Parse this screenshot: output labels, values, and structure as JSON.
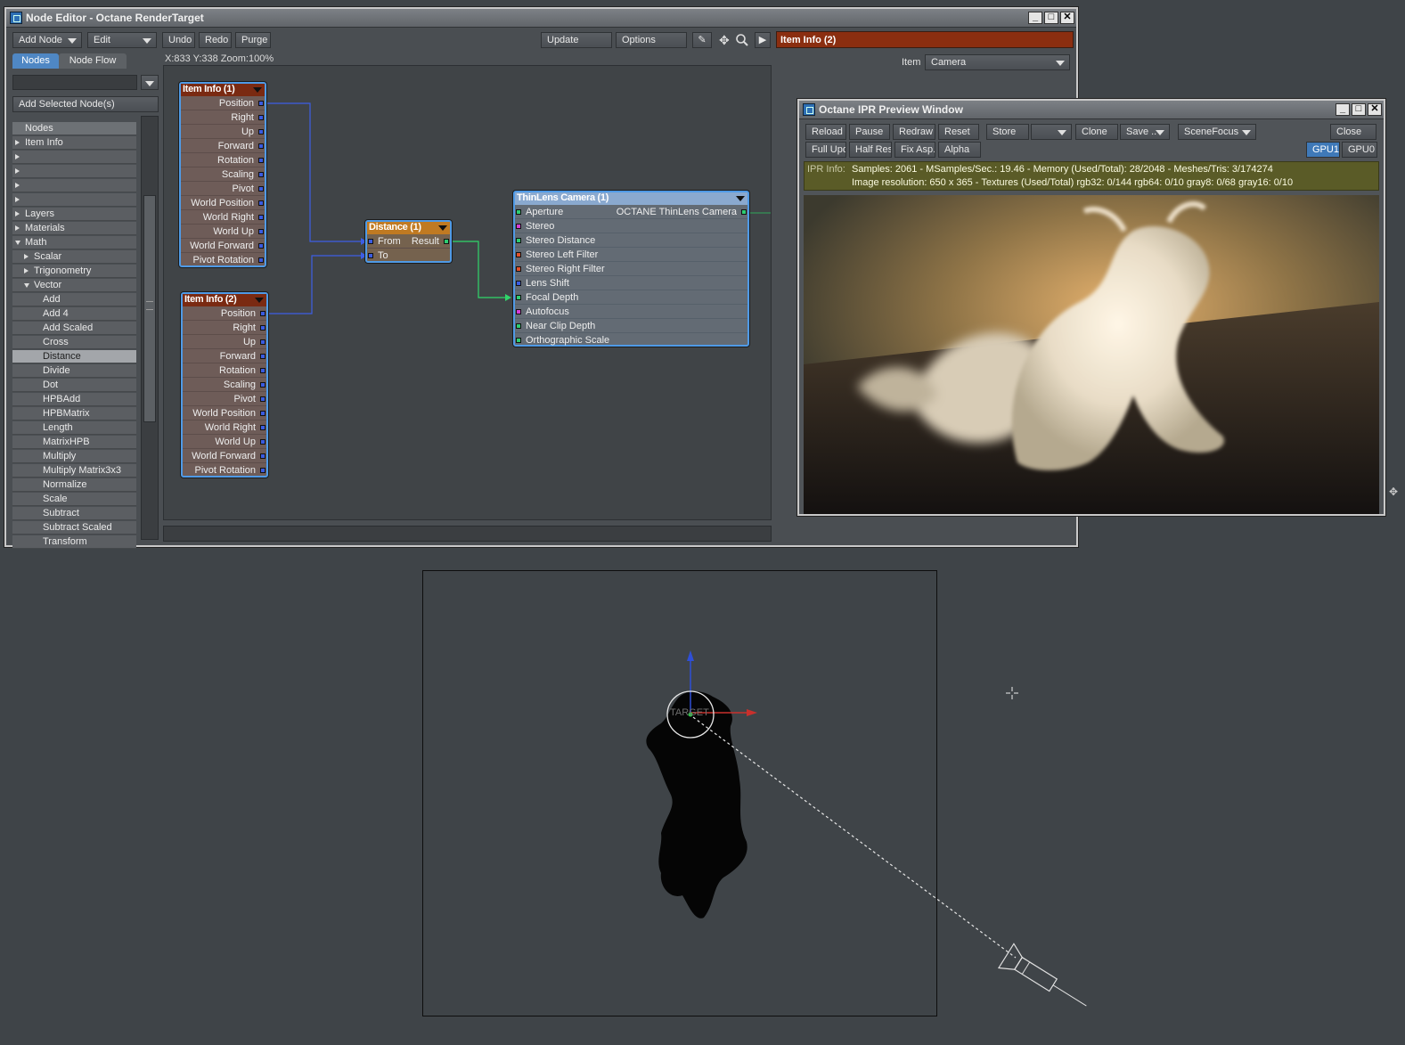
{
  "node_editor": {
    "title": "Node Editor - Octane RenderTarget",
    "toolbar": {
      "add_node": "Add Node",
      "edit": "Edit",
      "undo": "Undo",
      "redo": "Redo",
      "purge": "Purge",
      "update": "Update",
      "options": "Options"
    },
    "tabs": [
      "Nodes",
      "Node Flow"
    ],
    "add_selected": "Add Selected Node(s)",
    "coords": "X:833 Y:338 Zoom:100%",
    "selected_node": "Item Info (2)",
    "item_label": "Item",
    "item_value": "Camera",
    "tree": {
      "header": "Nodes",
      "items": [
        "Item Info",
        "",
        "",
        "",
        "",
        "Layers",
        "Materials",
        "Math",
        "Scalar",
        "Trigonometry",
        "Vector",
        "Add",
        "Add 4",
        "Add Scaled",
        "Cross",
        "Distance",
        "Divide",
        "Dot",
        "HPBAdd",
        "HPBMatrix",
        "Length",
        "MatrixHPB",
        "Multiply",
        "Multiply Matrix3x3",
        "Normalize",
        "Scale",
        "Subtract",
        "Subtract Scaled",
        "Transform"
      ]
    },
    "nodes": {
      "item_info_1": {
        "title": "Item Info (1)",
        "outputs": [
          "Position",
          "Right",
          "Up",
          "Forward",
          "Rotation",
          "Scaling",
          "Pivot",
          "World Position",
          "World Right",
          "World Up",
          "World Forward",
          "Pivot Rotation"
        ]
      },
      "item_info_2": {
        "title": "Item Info (2)",
        "outputs": [
          "Position",
          "Right",
          "Up",
          "Forward",
          "Rotation",
          "Scaling",
          "Pivot",
          "World Position",
          "World Right",
          "World Up",
          "World Forward",
          "Pivot Rotation"
        ]
      },
      "distance": {
        "title": "Distance (1)",
        "from": "From",
        "to": "To",
        "result": "Result"
      },
      "camera": {
        "title": "ThinLens Camera (1)",
        "output": "OCTANE ThinLens Camera",
        "inputs": [
          "Aperture",
          "Stereo",
          "Stereo Distance",
          "Stereo Left Filter",
          "Stereo Right Filter",
          "Lens Shift",
          "Focal Depth",
          "Autofocus",
          "Near Clip Depth",
          "Orthographic Scale"
        ],
        "input_colors": [
          "#2ecc71",
          "#d63ad6",
          "#2ecc71",
          "#e0502a",
          "#e0502a",
          "#3b5ce0",
          "#2ecc71",
          "#d63ad6",
          "#2ecc71",
          "#2ecc71"
        ]
      }
    }
  },
  "ipr": {
    "title": "Octane IPR Preview Window",
    "buttons_row1": [
      "Reload",
      "Pause",
      "Redraw",
      "Reset",
      "Store",
      "",
      "Clone",
      "Save ..",
      "SceneFocus",
      "Close"
    ],
    "buttons_row2": [
      "Full Upd.",
      "Half Res",
      "Fix Asp.",
      "Alpha"
    ],
    "gpu": [
      "GPU1",
      "GPU0"
    ],
    "info_label": "IPR Info:",
    "info_line1": "Samples: 2061  -  MSamples/Sec.: 19.46  -  Memory (Used/Total): 28/2048  -  Meshes/Tris: 3/174274",
    "info_line2": "Image resolution: 650 x 365 - Textures (Used/Total) rgb32: 0/144  rgb64: 0/10  gray8: 0/68  gray16: 0/10"
  },
  "viewport": {
    "target_label": "TARGET"
  }
}
